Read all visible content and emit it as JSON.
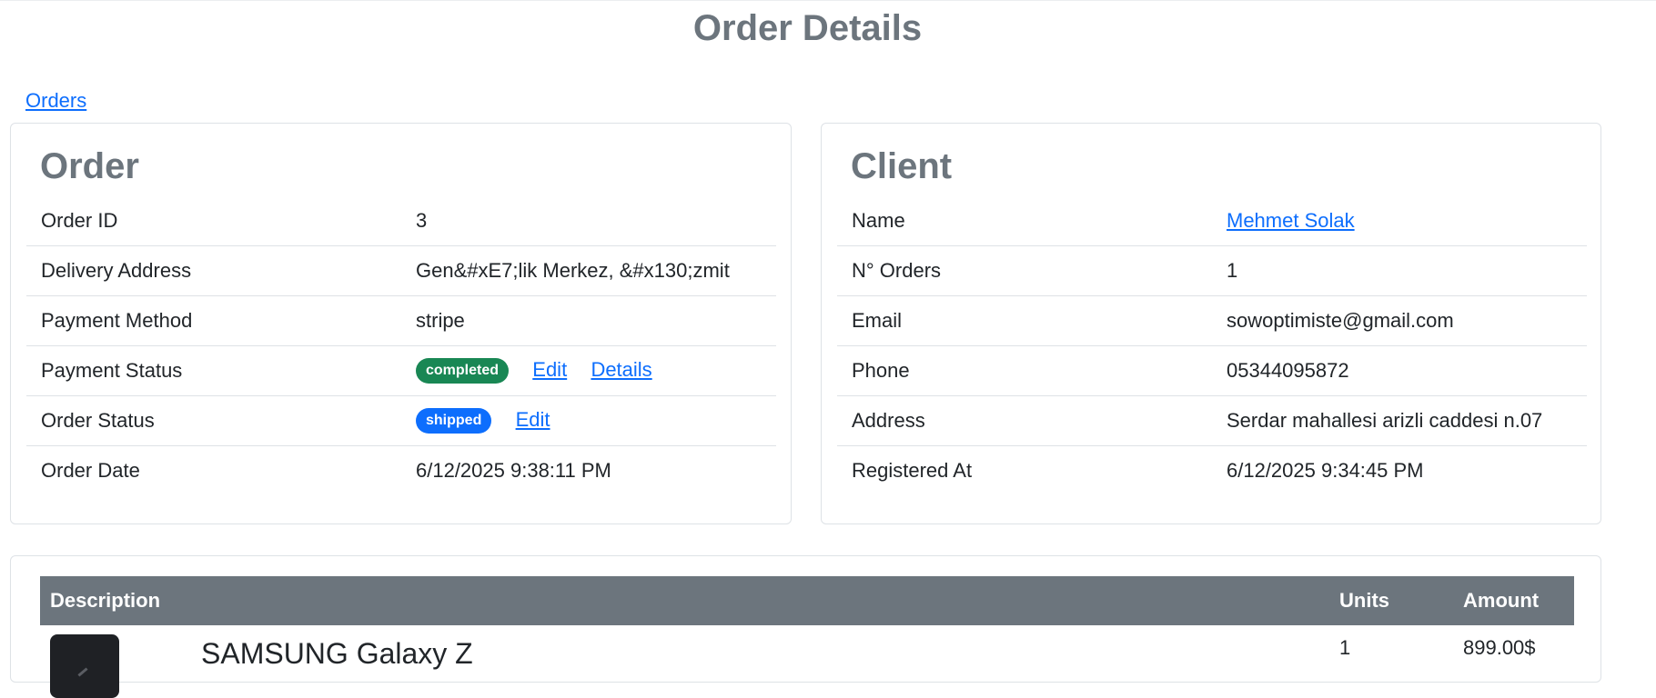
{
  "page": {
    "title": "Order Details"
  },
  "breadcrumb": {
    "orders_link": "Orders"
  },
  "order": {
    "heading": "Order",
    "rows": {
      "order_id": {
        "label": "Order ID",
        "value": "3"
      },
      "delivery_address": {
        "label": "Delivery Address",
        "value": "Gen&#xE7;lik Merkez, &#x130;zmit"
      },
      "payment_method": {
        "label": "Payment Method",
        "value": "stripe"
      },
      "payment_status": {
        "label": "Payment Status",
        "badge": "completed",
        "edit_link": "Edit",
        "details_link": "Details"
      },
      "order_status": {
        "label": "Order Status",
        "badge": "shipped",
        "edit_link": "Edit"
      },
      "order_date": {
        "label": "Order Date",
        "value": "6/12/2025 9:38:11 PM"
      }
    }
  },
  "client": {
    "heading": "Client",
    "rows": {
      "name": {
        "label": "Name",
        "value": "Mehmet Solak"
      },
      "orders_count": {
        "label": "N° Orders",
        "value": "1"
      },
      "email": {
        "label": "Email",
        "value": "sowoptimiste@gmail.com"
      },
      "phone": {
        "label": "Phone",
        "value": "05344095872"
      },
      "address": {
        "label": "Address",
        "value": "Serdar mahallesi arizli caddesi n.07"
      },
      "registered_at": {
        "label": "Registered At",
        "value": "6/12/2025 9:34:45 PM"
      }
    }
  },
  "items": {
    "columns": {
      "description": "Description",
      "units": "Units",
      "amount": "Amount"
    },
    "rows": [
      {
        "name": "SAMSUNG Galaxy Z",
        "units": "1",
        "amount": "899.00$",
        "thumb_icon": "phone-thumbnail"
      }
    ]
  },
  "colors": {
    "heading_gray": "#6c757d",
    "link_blue": "#0d6efd",
    "badge_completed": "#198754",
    "badge_shipped": "#0d6efd",
    "table_header": "#6c757d"
  }
}
